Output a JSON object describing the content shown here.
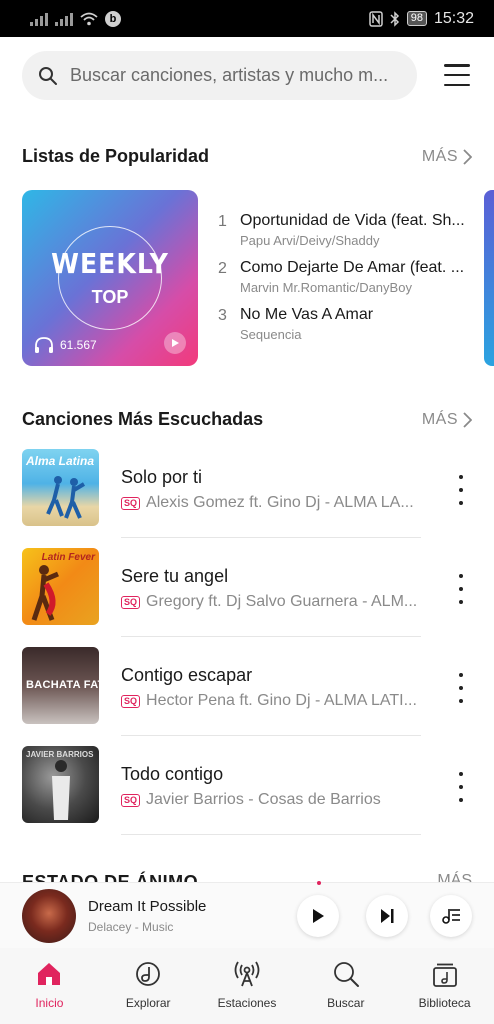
{
  "status_bar": {
    "battery": "98",
    "time": "15:32"
  },
  "search": {
    "placeholder": "Buscar canciones, artistas y mucho m..."
  },
  "charts_section": {
    "title": "Listas de Popularidad",
    "more_label": "MÁS",
    "card": {
      "title_line1": "WEEKLY",
      "title_line2": "TOP",
      "play_count": "61.567"
    },
    "ranking": [
      {
        "rank": "1",
        "title": "Oportunidad de Vida (feat. Sh...",
        "artist": "Papu Arvi/Deivy/Shaddy"
      },
      {
        "rank": "2",
        "title": "Como Dejarte De Amar (feat. ...",
        "artist": "Marvin Mr.Romantic/DanyBoy"
      },
      {
        "rank": "3",
        "title": "No Me Vas A Amar",
        "artist": "Sequencia"
      }
    ]
  },
  "top_songs_section": {
    "title": "Canciones Más Escuchadas",
    "more_label": "MÁS",
    "quality_badge": "SQ",
    "songs": [
      {
        "title": "Solo por ti",
        "artist": "Alexis Gomez ft. Gino Dj - ALMA LA...",
        "cover_text": "Alma Latina"
      },
      {
        "title": "Sere tu angel",
        "artist": "Gregory ft. Dj Salvo Guarnera - ALM...",
        "cover_text": "Latin Fever"
      },
      {
        "title": "Contigo escapar",
        "artist": "Hector Pena ft. Gino Dj - ALMA LATI...",
        "cover_text": "BACHATA FATAL"
      },
      {
        "title": "Todo contigo",
        "artist": "Javier Barrios - Cosas de Barrios",
        "cover_text": "JAVIER BARRIOS"
      }
    ]
  },
  "mood_section": {
    "title": "ESTADO DE ÁNIMO",
    "more_label": "MÁS"
  },
  "player": {
    "title": "Dream It Possible",
    "artist": "Delacey - Music"
  },
  "nav": [
    {
      "label": "Inicio",
      "icon": "home-icon",
      "active": true
    },
    {
      "label": "Explorar",
      "icon": "explore-icon"
    },
    {
      "label": "Estaciones",
      "icon": "radio-icon"
    },
    {
      "label": "Buscar",
      "icon": "search-icon"
    },
    {
      "label": "Biblioteca",
      "icon": "library-icon"
    }
  ],
  "colors": {
    "accent": "#e0245e"
  }
}
